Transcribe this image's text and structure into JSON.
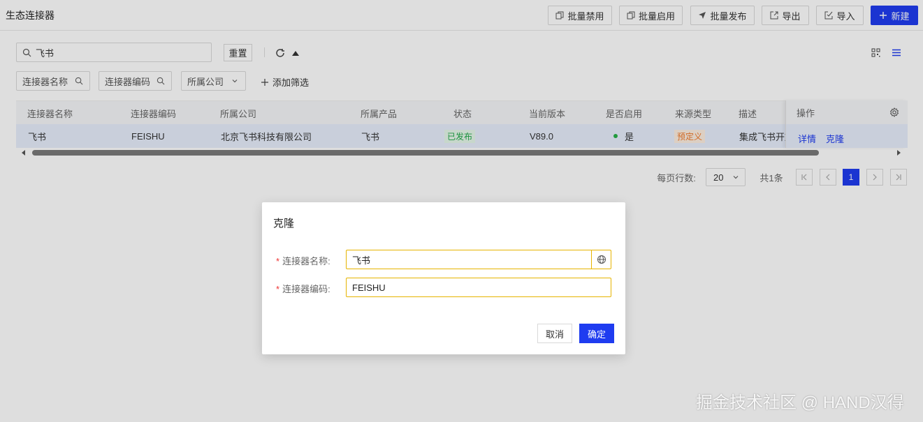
{
  "header": {
    "title": "生态连接器",
    "buttons": {
      "batch_disable": "批量禁用",
      "batch_enable": "批量启用",
      "batch_publish": "批量发布",
      "export": "导出",
      "import": "导入",
      "create": "新建"
    }
  },
  "search": {
    "value": "飞书",
    "reset_label": "重置"
  },
  "filters": {
    "connector_name": "连接器名称",
    "connector_code": "连接器编码",
    "company": "所属公司",
    "add_filter": "添加筛选"
  },
  "table": {
    "columns": [
      "连接器名称",
      "连接器编码",
      "所属公司",
      "所属产品",
      "状态",
      "当前版本",
      "是否启用",
      "来源类型",
      "描述",
      "操作"
    ],
    "rows": [
      {
        "name": "飞书",
        "code": "FEISHU",
        "company": "北京飞书科技有限公司",
        "product": "飞书",
        "status": "已发布",
        "version": "V89.0",
        "enabled": "是",
        "source": "预定义",
        "description": "集成飞书开放",
        "action_detail": "详情",
        "action_clone": "克隆"
      }
    ]
  },
  "pagination": {
    "rows_per_page_label": "每页行数:",
    "page_size": "20",
    "total": "共1条",
    "current_page": "1"
  },
  "modal": {
    "title": "克隆",
    "name_label": "连接器名称:",
    "name_value": "飞书",
    "code_label": "连接器编码:",
    "code_value": "FEISHU",
    "cancel_label": "取消",
    "confirm_label": "确定"
  },
  "watermark": "掘金技术社区 @ HAND汉得",
  "colors": {
    "primary": "#1f3cf0",
    "required": "#e33333",
    "focus_border": "#e6b400",
    "status_published": "#21a849",
    "source_predefined": "#f07b2c"
  }
}
